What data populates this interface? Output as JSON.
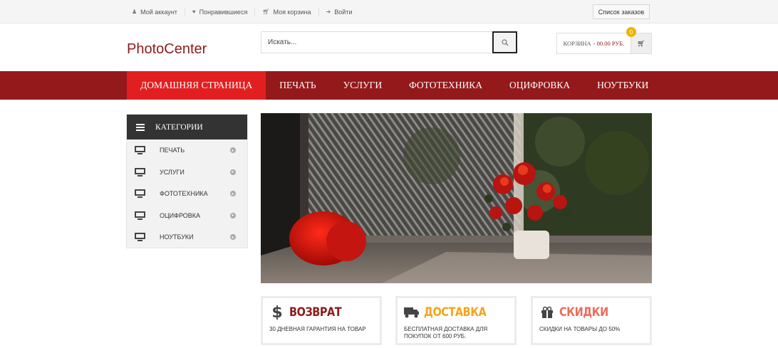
{
  "topbar": {
    "links": [
      {
        "label": "Мой аккаунт",
        "icon": "user-icon"
      },
      {
        "label": "Понравившиеся",
        "icon": "heart-icon"
      },
      {
        "label": "Моя корзина",
        "icon": "cart-icon"
      },
      {
        "label": "Войти",
        "icon": "login-icon"
      }
    ],
    "orders_label": "Список заказов"
  },
  "header": {
    "logo": "PhotoCenter",
    "search_placeholder": "Искать...",
    "cart_label": "КОРЗИНА",
    "cart_sum": "- 00.00 РУБ.",
    "cart_count": "0"
  },
  "nav": {
    "items": [
      {
        "label": "ДОМАШНЯЯ СТРАНИЦА",
        "active": true
      },
      {
        "label": "ПЕЧАТЬ"
      },
      {
        "label": "УСЛУГИ"
      },
      {
        "label": "ФОТОТЕХНИКА"
      },
      {
        "label": "ОЦИФРОВКА"
      },
      {
        "label": "НОУТБУКИ"
      }
    ]
  },
  "sidebar": {
    "title": "КАТЕГОРИИ",
    "items": [
      {
        "label": "ПЕЧАТЬ"
      },
      {
        "label": "УСЛУГИ"
      },
      {
        "label": "ФОТОТЕХНИКА"
      },
      {
        "label": "ОЦИФРОВКА"
      },
      {
        "label": "НОУТБУКИ"
      }
    ]
  },
  "features": [
    {
      "title": "ВОЗВРАТ",
      "desc": "30 ДНЕВНАЯ ГАРАНТИЯ НА ТОВАР",
      "color": "#8f1a1a",
      "icon": "dollar-icon"
    },
    {
      "title": "ДОСТАВКА",
      "desc": "БЕСПЛАТНАЯ ДОСТАВКА ДЛЯ ПОКУПОК ОТ 600 РУБ.",
      "color": "#f5a31a",
      "icon": "truck-icon"
    },
    {
      "title": "СКИДКИ",
      "desc": "СКИДКИ НА ТОВАРЫ ДО 50%",
      "color": "#ef6a5a",
      "icon": "gift-icon"
    }
  ],
  "colors": {
    "brand": "#8f1a1a",
    "nav_bg": "#94191b",
    "nav_active": "#e21f20",
    "badge": "#f0b400"
  }
}
